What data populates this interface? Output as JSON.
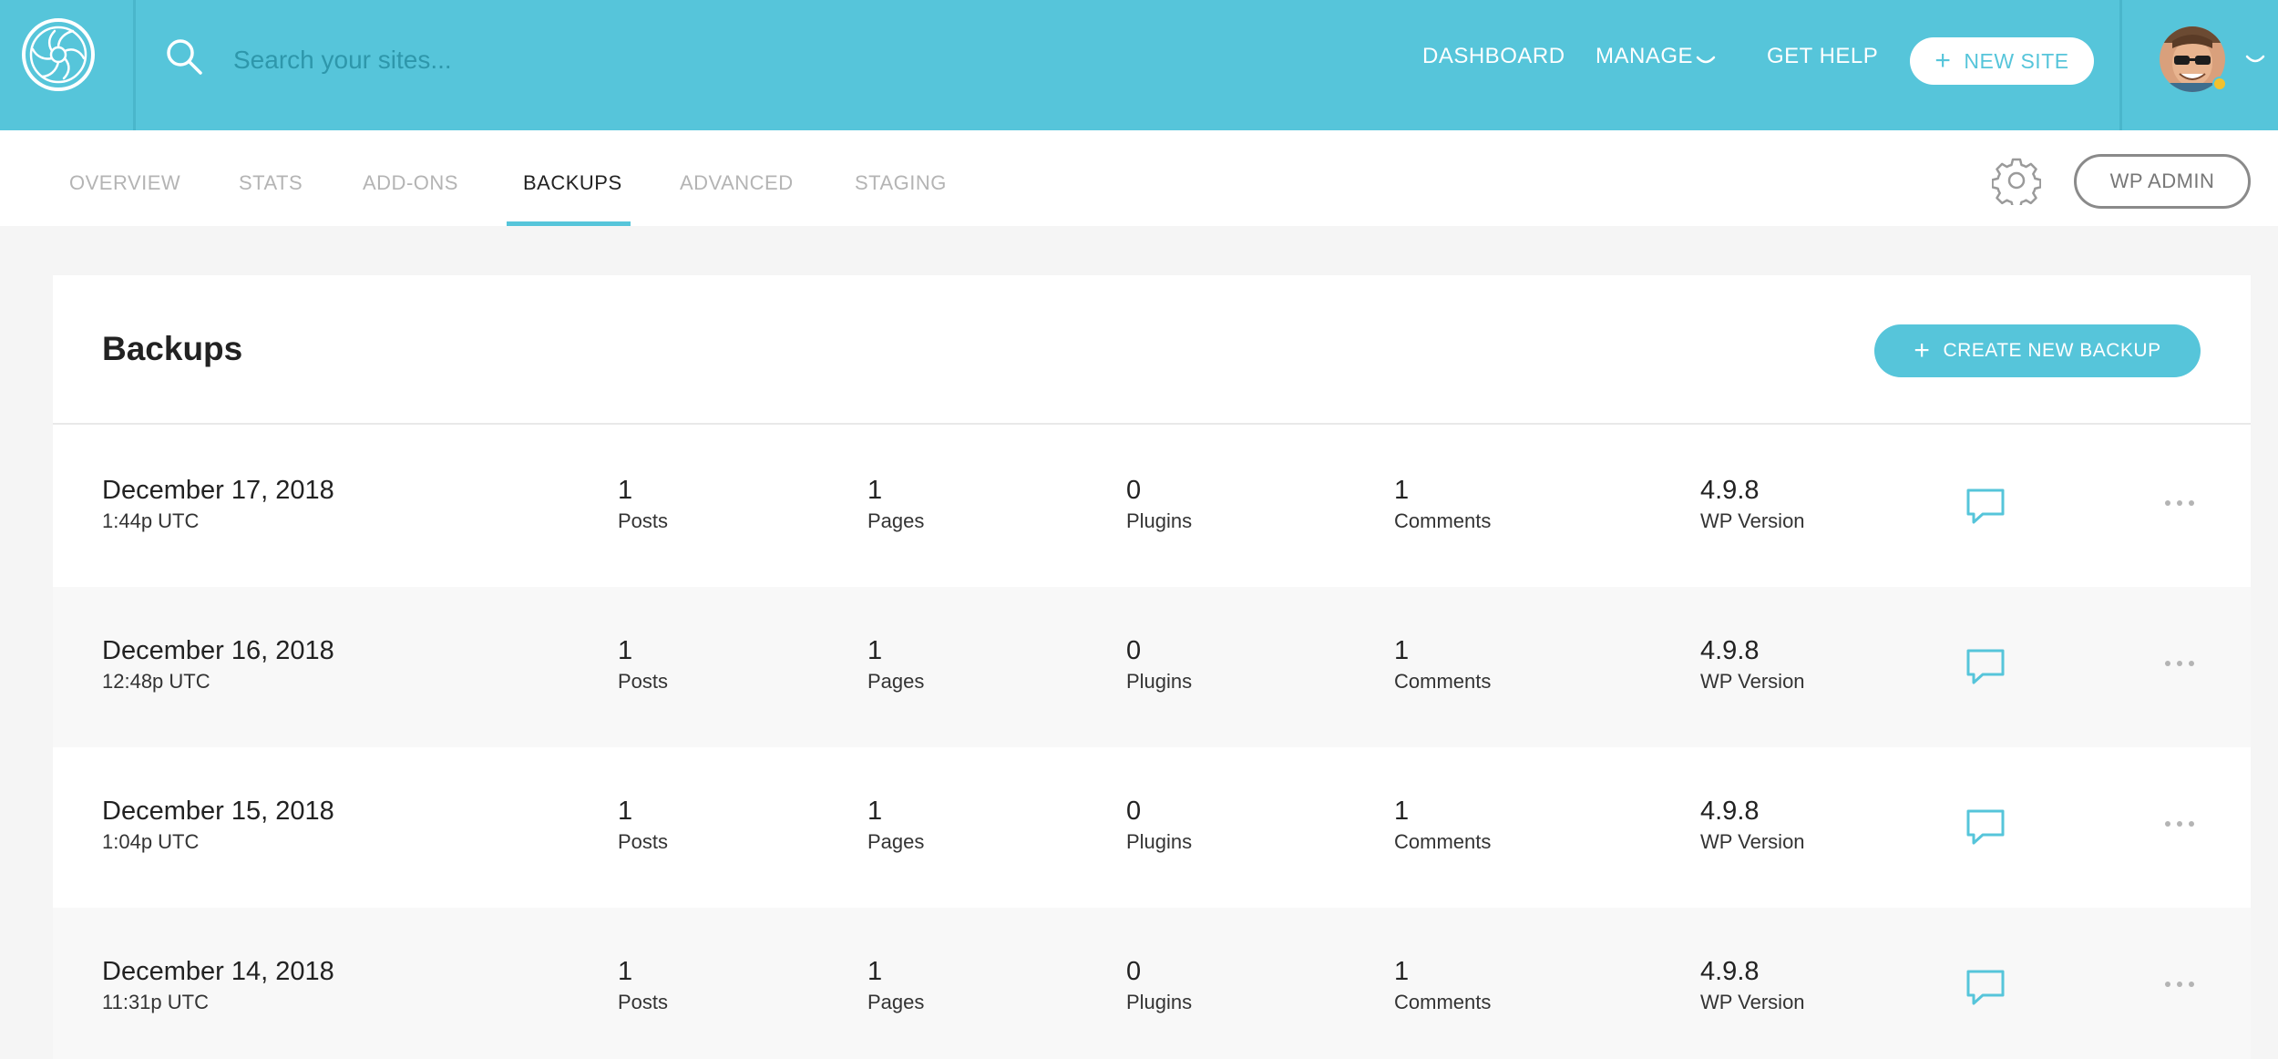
{
  "colors": {
    "accent": "#56c5da",
    "status_dot": "#f2c12e"
  },
  "header": {
    "search_placeholder": "Search your sites...",
    "nav": {
      "dashboard": "DASHBOARD",
      "manage": "MANAGE",
      "get_help": "GET HELP"
    },
    "new_site_label": "NEW SITE"
  },
  "tabs": {
    "overview": "OVERVIEW",
    "stats": "STATS",
    "addons": "ADD-ONS",
    "backups": "BACKUPS",
    "advanced": "ADVANCED",
    "staging": "STAGING",
    "active": "BACKUPS"
  },
  "wp_admin_label": "WP ADMIN",
  "backups": {
    "title": "Backups",
    "create_label": "CREATE NEW BACKUP",
    "rows": [
      {
        "date": "December 17, 2018",
        "time": "1:44p UTC",
        "posts": "1",
        "posts_label": "Posts",
        "pages": "1",
        "pages_label": "Pages",
        "plugins": "0",
        "plugins_label": "Plugins",
        "comments": "1",
        "comments_label": "Comments",
        "wp_version": "4.9.8",
        "wp_version_label": "WP Version"
      },
      {
        "date": "December 16, 2018",
        "time": "12:48p UTC",
        "posts": "1",
        "posts_label": "Posts",
        "pages": "1",
        "pages_label": "Pages",
        "plugins": "0",
        "plugins_label": "Plugins",
        "comments": "1",
        "comments_label": "Comments",
        "wp_version": "4.9.8",
        "wp_version_label": "WP Version"
      },
      {
        "date": "December 15, 2018",
        "time": "1:04p UTC",
        "posts": "1",
        "posts_label": "Posts",
        "pages": "1",
        "pages_label": "Pages",
        "plugins": "0",
        "plugins_label": "Plugins",
        "comments": "1",
        "comments_label": "Comments",
        "wp_version": "4.9.8",
        "wp_version_label": "WP Version"
      },
      {
        "date": "December 14, 2018",
        "time": "11:31p UTC",
        "posts": "1",
        "posts_label": "Posts",
        "pages": "1",
        "pages_label": "Pages",
        "plugins": "0",
        "plugins_label": "Plugins",
        "comments": "1",
        "comments_label": "Comments",
        "wp_version": "4.9.8",
        "wp_version_label": "WP Version"
      }
    ]
  },
  "icons": {
    "logo": "flywheel-logo-icon",
    "search": "search-icon",
    "manage_chevron": "chevron-down-icon",
    "plus": "plus-icon",
    "account_chevron": "chevron-down-icon",
    "settings": "gear-icon",
    "note": "comment-bubble-icon",
    "more": "ellipsis-icon"
  }
}
